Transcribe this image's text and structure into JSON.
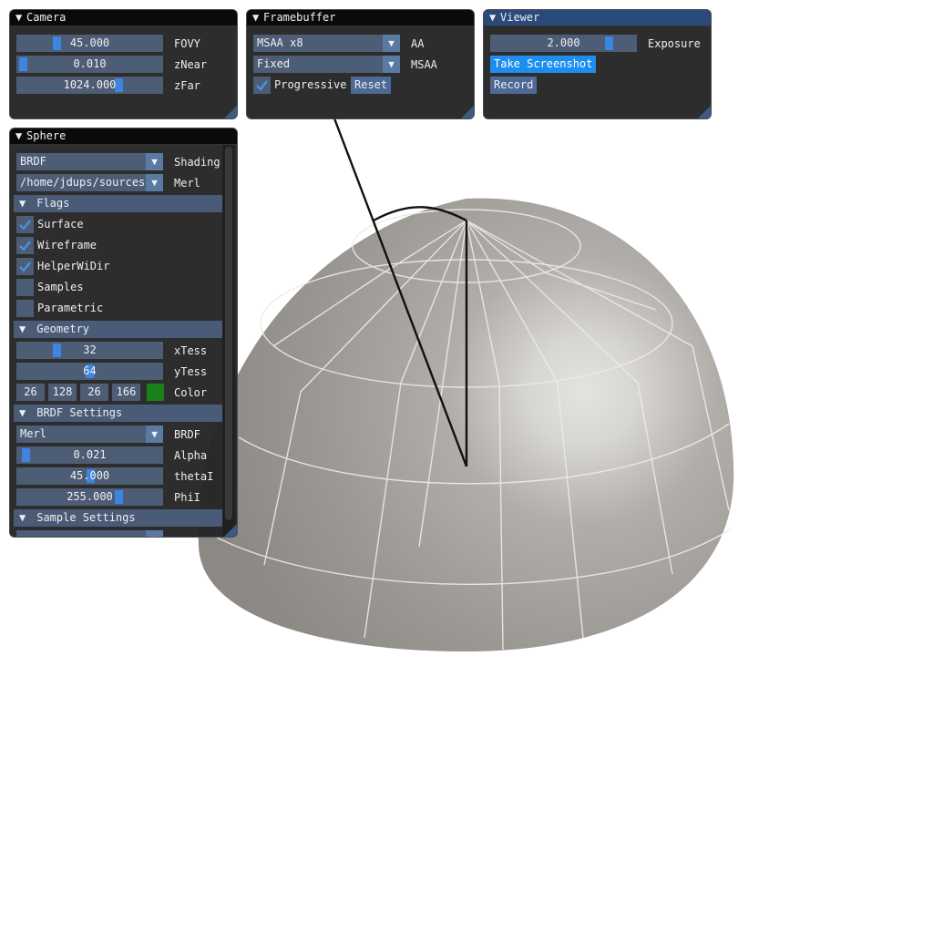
{
  "camera": {
    "title": "Camera",
    "fovy": {
      "value": "45.000",
      "label": "FOVY",
      "fraction": 0.26
    },
    "znear": {
      "value": "0.010",
      "label": "zNear",
      "fraction": 0.0
    },
    "zfar": {
      "value": "1024.000",
      "label": "zFar",
      "fraction": 0.69
    }
  },
  "framebuffer": {
    "title": "Framebuffer",
    "aa": {
      "value": "MSAA x8",
      "label": "AA"
    },
    "msaa": {
      "value": "Fixed",
      "label": "MSAA"
    },
    "progressive": {
      "label": "Progressive",
      "checked": true
    },
    "reset_label": "Reset"
  },
  "viewer": {
    "title": "Viewer",
    "exposure": {
      "value": "2.000",
      "label": "Exposure",
      "fraction": 0.82
    },
    "screenshot_label": "Take Screenshot",
    "record_label": "Record"
  },
  "sphere": {
    "title": "Sphere",
    "shading": {
      "value": "BRDF",
      "label": "Shading"
    },
    "merl_path": {
      "value": "/home/jdups/sources/",
      "label": "Merl"
    },
    "flags": {
      "header": "Flags",
      "items": [
        {
          "label": "Surface",
          "checked": true
        },
        {
          "label": "Wireframe",
          "checked": true
        },
        {
          "label": "HelperWiDir",
          "checked": true
        },
        {
          "label": "Samples",
          "checked": false
        },
        {
          "label": "Parametric",
          "checked": false
        }
      ]
    },
    "geometry": {
      "header": "Geometry",
      "xtess": {
        "value": "32",
        "label": "xTess",
        "fraction": 0.26
      },
      "ytess": {
        "value": "64",
        "label": "yTess",
        "fraction": 0.5
      },
      "color": {
        "r": "26",
        "g": "128",
        "b": "26",
        "a": "166",
        "label": "Color",
        "swatch": "#1a801a"
      }
    },
    "brdf_settings": {
      "header": "BRDF Settings",
      "brdf": {
        "value": "Merl",
        "label": "BRDF"
      },
      "alpha": {
        "value": "0.021",
        "label": "Alpha",
        "fraction": 0.02
      },
      "thetai": {
        "value": "45.000",
        "label": "thetaI",
        "fraction": 0.5
      },
      "phii": {
        "value": "255.000",
        "label": "PhiI",
        "fraction": 0.71
      }
    },
    "sample_settings": {
      "header": "Sample Settings"
    }
  },
  "icons": {
    "collapse": "triangle-down-icon",
    "check": "checkmark-icon",
    "combo_arrow": "triangle-down-icon"
  },
  "colors": {
    "accent": "#3d85e0",
    "button_active": "#1c8ef0",
    "sphere_color": "#1a801a",
    "viewport_bg": "#ffffff"
  }
}
